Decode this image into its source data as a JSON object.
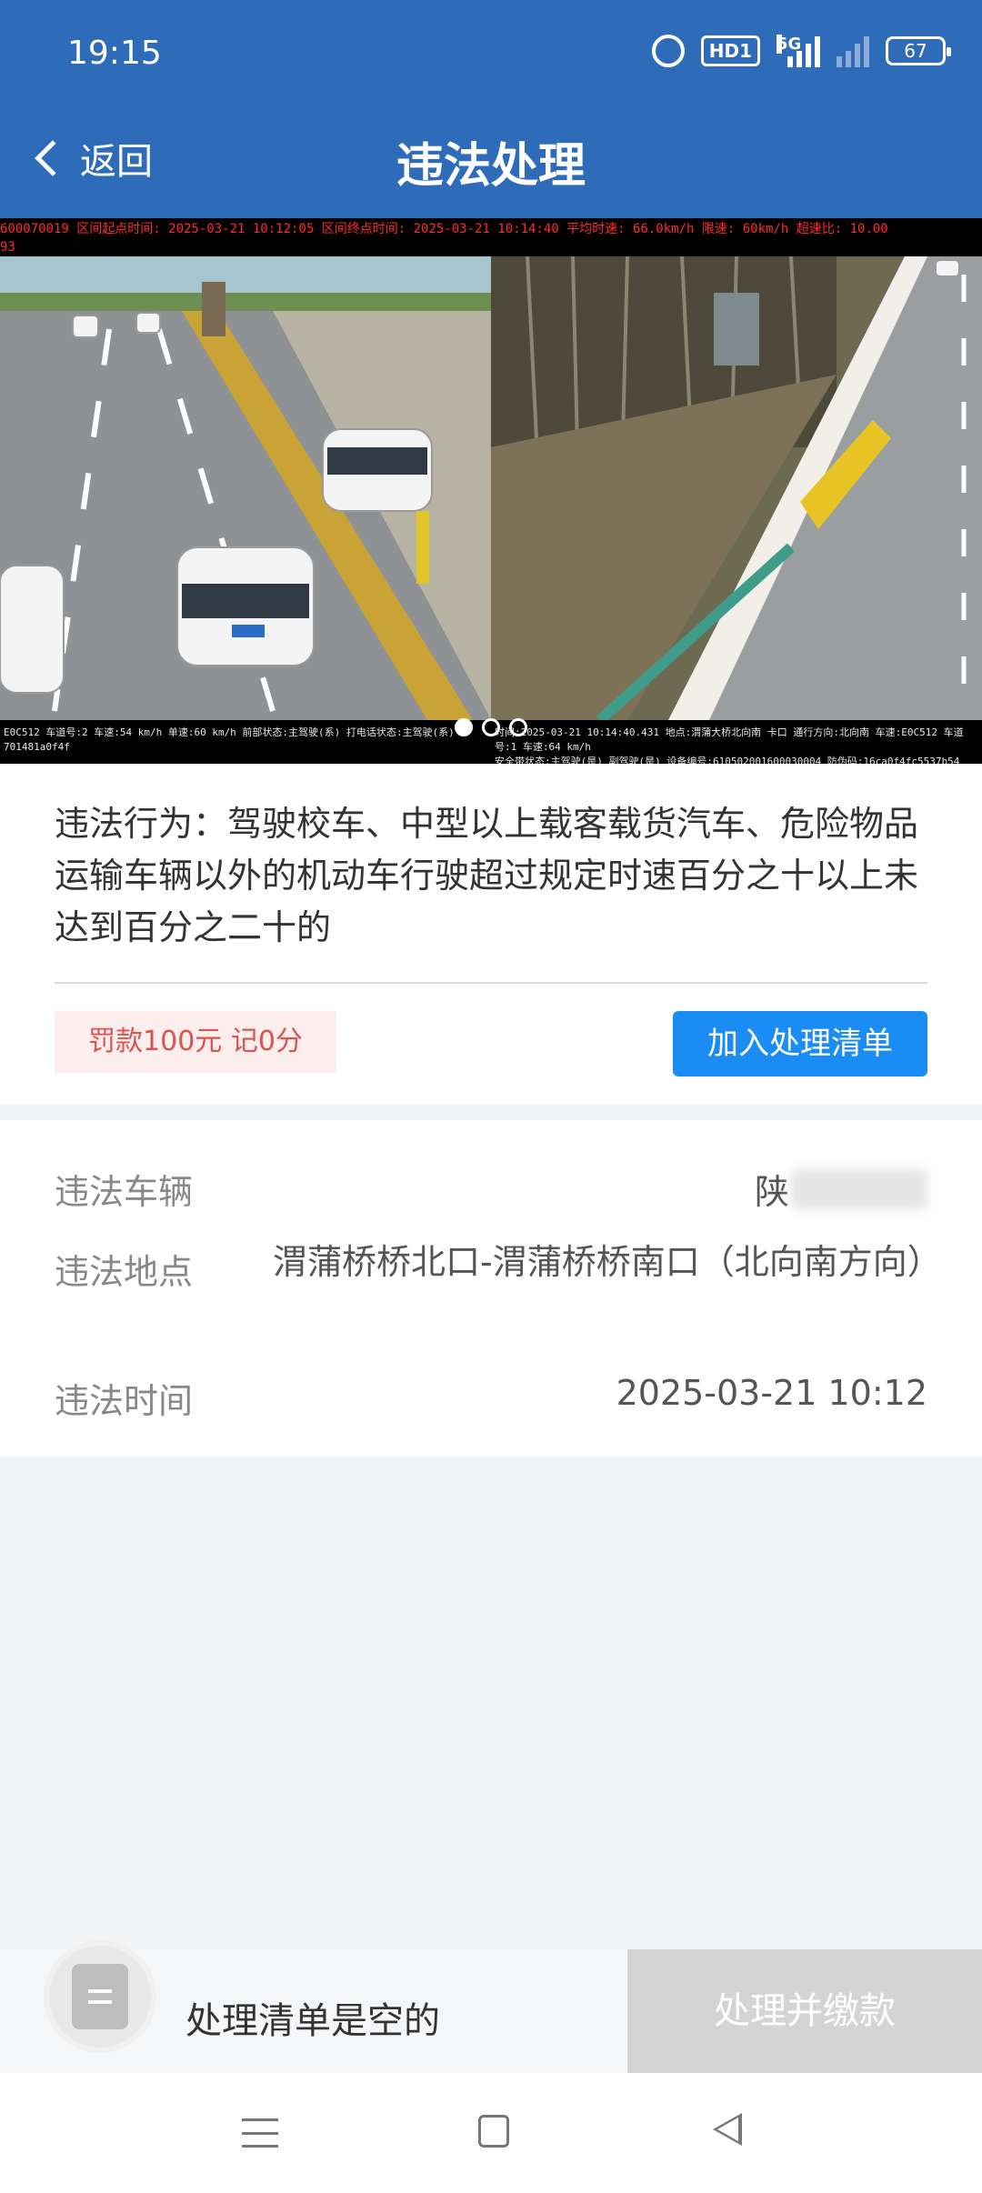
{
  "status_bar": {
    "time": "19:15",
    "hd_label": "HD1",
    "network_label": "5G",
    "battery": "67",
    "icons": [
      "alarm-icon",
      "hd-icon",
      "signal-icon",
      "signal-secondary-icon",
      "battery-icon"
    ]
  },
  "header": {
    "back_label": "返回",
    "title": "违法处理",
    "color": "#2e6bb8"
  },
  "photo": {
    "caption_top_line1": "600070019 区间起点时间: 2025-03-21 10:12:05 区间终点时间: 2025-03-21 10:14:40 平均时速: 66.0km/h 限速: 60km/h 超速比: 10.00",
    "caption_top_line2": "93",
    "caption_bottom_left_line1": "E0C512 车道号:2 车速:54 km/h 单速:60 km/h 前部状态:主驾驶(系) 打电话状态:主驾驶(系)",
    "caption_bottom_left_line2": "701481a0f4f",
    "caption_bottom_right_line1": "时间:2025-03-21 10:14:40.431 地点:渭蒲大桥北向南 卡口 通行方向:北向南 车速:E0C512 车道号:1 车速:64 km/h",
    "caption_bottom_right_line2": "安全带状态:主驾驶(是) 副驾驶(是) 设备编号:610502001600030004 防伪码:16ca0f4fc5537b54",
    "slide_count": 3,
    "active_slide": 1
  },
  "violation": {
    "behavior": "违法行为：驾驶校车、中型以上载客载货汽车、危险物品运输车辆以外的机动车行驶超过规定时速百分之十以上未达到百分之二十的",
    "fine_label": "罚款100元 记0分",
    "add_button_label": "加入处理清单"
  },
  "details": {
    "vehicle_label": "违法车辆",
    "vehicle_value": "陕",
    "location_label": "违法地点",
    "location_value": "渭蒲桥桥北口-渭蒲桥桥南口（北向南方向）",
    "time_label": "违法时间",
    "time_value": "2025-03-21 10:12"
  },
  "bottom_bar": {
    "empty_label": "处理清单是空的",
    "pay_button_label": "处理并缴款"
  },
  "system_nav": {
    "icons": [
      "menu-icon",
      "home-icon",
      "back-icon"
    ]
  }
}
